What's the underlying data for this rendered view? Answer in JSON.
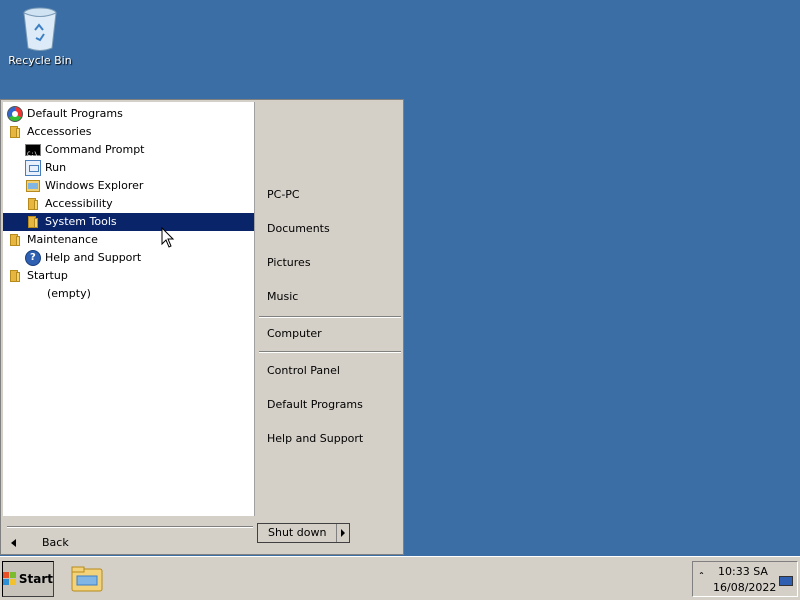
{
  "desktop": {
    "recycle_bin_label": "Recycle Bin"
  },
  "start_menu": {
    "programs": [
      {
        "label": "Default Programs",
        "icon": "default-programs-icon",
        "level": 0
      },
      {
        "label": "Accessories",
        "icon": "folder-icon",
        "level": 0
      },
      {
        "label": "Command Prompt",
        "icon": "command-prompt-icon",
        "level": 1
      },
      {
        "label": "Run",
        "icon": "run-icon",
        "level": 1
      },
      {
        "label": "Windows Explorer",
        "icon": "windows-explorer-icon",
        "level": 1
      },
      {
        "label": "Accessibility",
        "icon": "folder-icon",
        "level": 1
      },
      {
        "label": "System Tools",
        "icon": "folder-icon",
        "level": 1,
        "selected": true
      },
      {
        "label": "Maintenance",
        "icon": "folder-icon",
        "level": 0
      },
      {
        "label": "Help and Support",
        "icon": "help-icon",
        "level": 1
      },
      {
        "label": "Startup",
        "icon": "folder-icon",
        "level": 0
      },
      {
        "label": "(empty)",
        "icon": "",
        "level": 1
      }
    ],
    "back_label": "Back",
    "right_items": {
      "pc": "PC-PC",
      "documents": "Documents",
      "pictures": "Pictures",
      "music": "Music",
      "computer": "Computer",
      "control_panel": "Control Panel",
      "default_programs": "Default Programs",
      "help_support": "Help and Support"
    },
    "shutdown_label": "Shut down"
  },
  "taskbar": {
    "start_label": "Start",
    "time": "10:33 SA",
    "date": "16/08/2022"
  },
  "colors": {
    "desktop": "#3a6ea5",
    "selection": "#0a246a",
    "menu_face": "#d4d0c8"
  }
}
